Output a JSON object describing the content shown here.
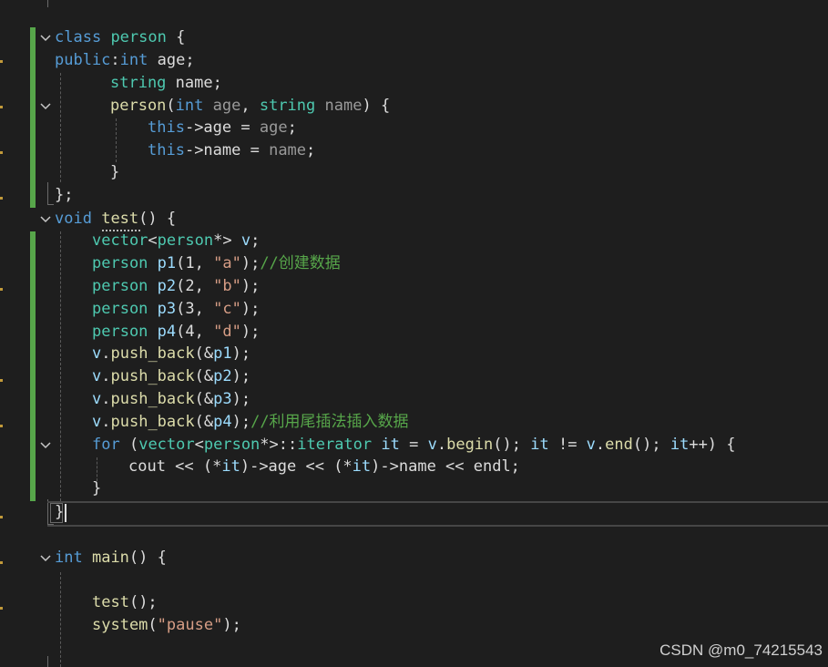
{
  "editor": {
    "lines": [
      [
        {
          "c": "kw",
          "t": "class"
        },
        {
          "c": "pl",
          "t": " "
        },
        {
          "c": "ty",
          "t": "person"
        },
        {
          "c": "pl",
          "t": " {"
        }
      ],
      [
        {
          "c": "kw",
          "t": "public"
        },
        {
          "c": "pl",
          "t": ":"
        },
        {
          "c": "kw",
          "t": "int"
        },
        {
          "c": "pl",
          "t": " "
        },
        {
          "c": "pl",
          "t": "age;"
        }
      ],
      [
        {
          "c": "ty",
          "t": "string"
        },
        {
          "c": "pl",
          "t": " name;"
        }
      ],
      [
        {
          "c": "fn",
          "t": "person"
        },
        {
          "c": "pl",
          "t": "("
        },
        {
          "c": "kw",
          "t": "int"
        },
        {
          "c": "pl",
          "t": " "
        },
        {
          "c": "pm",
          "t": "age"
        },
        {
          "c": "pl",
          "t": ", "
        },
        {
          "c": "ty",
          "t": "string"
        },
        {
          "c": "pl",
          "t": " "
        },
        {
          "c": "pm",
          "t": "name"
        },
        {
          "c": "pl",
          "t": ") {"
        }
      ],
      [
        {
          "c": "kw",
          "t": "this"
        },
        {
          "c": "pl",
          "t": "->age = "
        },
        {
          "c": "pm",
          "t": "age"
        },
        {
          "c": "pl",
          "t": ";"
        }
      ],
      [
        {
          "c": "kw",
          "t": "this"
        },
        {
          "c": "pl",
          "t": "->name = "
        },
        {
          "c": "pm",
          "t": "name"
        },
        {
          "c": "pl",
          "t": ";"
        }
      ],
      [
        {
          "c": "pl",
          "t": "}"
        }
      ],
      [
        {
          "c": "pl",
          "t": "};"
        }
      ],
      [
        {
          "c": "kw",
          "t": "void"
        },
        {
          "c": "pl",
          "t": " "
        },
        {
          "c": "fn",
          "t": "test"
        },
        {
          "c": "pl",
          "t": "() {"
        }
      ],
      [
        {
          "c": "ty",
          "t": "vector"
        },
        {
          "c": "pl",
          "t": "<"
        },
        {
          "c": "ty",
          "t": "person"
        },
        {
          "c": "pl",
          "t": "*> "
        },
        {
          "c": "lv",
          "t": "v"
        },
        {
          "c": "pl",
          "t": ";"
        }
      ],
      [
        {
          "c": "ty",
          "t": "person"
        },
        {
          "c": "pl",
          "t": " "
        },
        {
          "c": "lv",
          "t": "p1"
        },
        {
          "c": "pl",
          "t": "(1, "
        },
        {
          "c": "st",
          "t": "\"a\""
        },
        {
          "c": "pl",
          "t": ");"
        },
        {
          "c": "cm",
          "t": "//创建数据"
        }
      ],
      [
        {
          "c": "ty",
          "t": "person"
        },
        {
          "c": "pl",
          "t": " "
        },
        {
          "c": "lv",
          "t": "p2"
        },
        {
          "c": "pl",
          "t": "(2, "
        },
        {
          "c": "st",
          "t": "\"b\""
        },
        {
          "c": "pl",
          "t": ");"
        }
      ],
      [
        {
          "c": "ty",
          "t": "person"
        },
        {
          "c": "pl",
          "t": " "
        },
        {
          "c": "lv",
          "t": "p3"
        },
        {
          "c": "pl",
          "t": "(3, "
        },
        {
          "c": "st",
          "t": "\"c\""
        },
        {
          "c": "pl",
          "t": ");"
        }
      ],
      [
        {
          "c": "ty",
          "t": "person"
        },
        {
          "c": "pl",
          "t": " "
        },
        {
          "c": "lv",
          "t": "p4"
        },
        {
          "c": "pl",
          "t": "(4, "
        },
        {
          "c": "st",
          "t": "\"d\""
        },
        {
          "c": "pl",
          "t": ");"
        }
      ],
      [
        {
          "c": "lv",
          "t": "v"
        },
        {
          "c": "pl",
          "t": "."
        },
        {
          "c": "fn",
          "t": "push_back"
        },
        {
          "c": "pl",
          "t": "(&"
        },
        {
          "c": "lv",
          "t": "p1"
        },
        {
          "c": "pl",
          "t": ");"
        }
      ],
      [
        {
          "c": "lv",
          "t": "v"
        },
        {
          "c": "pl",
          "t": "."
        },
        {
          "c": "fn",
          "t": "push_back"
        },
        {
          "c": "pl",
          "t": "(&"
        },
        {
          "c": "lv",
          "t": "p2"
        },
        {
          "c": "pl",
          "t": ");"
        }
      ],
      [
        {
          "c": "lv",
          "t": "v"
        },
        {
          "c": "pl",
          "t": "."
        },
        {
          "c": "fn",
          "t": "push_back"
        },
        {
          "c": "pl",
          "t": "(&"
        },
        {
          "c": "lv",
          "t": "p3"
        },
        {
          "c": "pl",
          "t": ");"
        }
      ],
      [
        {
          "c": "lv",
          "t": "v"
        },
        {
          "c": "pl",
          "t": "."
        },
        {
          "c": "fn",
          "t": "push_back"
        },
        {
          "c": "pl",
          "t": "(&"
        },
        {
          "c": "lv",
          "t": "p4"
        },
        {
          "c": "pl",
          "t": ");"
        },
        {
          "c": "cm",
          "t": "//利用尾插法插入数据"
        }
      ],
      [
        {
          "c": "kw",
          "t": "for"
        },
        {
          "c": "pl",
          "t": " ("
        },
        {
          "c": "ty",
          "t": "vector"
        },
        {
          "c": "pl",
          "t": "<"
        },
        {
          "c": "ty",
          "t": "person"
        },
        {
          "c": "pl",
          "t": "*>::"
        },
        {
          "c": "ty",
          "t": "iterator"
        },
        {
          "c": "pl",
          "t": " "
        },
        {
          "c": "lv",
          "t": "it"
        },
        {
          "c": "pl",
          "t": " = "
        },
        {
          "c": "lv",
          "t": "v"
        },
        {
          "c": "pl",
          "t": "."
        },
        {
          "c": "fn",
          "t": "begin"
        },
        {
          "c": "pl",
          "t": "(); "
        },
        {
          "c": "lv",
          "t": "it"
        },
        {
          "c": "pl",
          "t": " != "
        },
        {
          "c": "lv",
          "t": "v"
        },
        {
          "c": "pl",
          "t": "."
        },
        {
          "c": "fn",
          "t": "end"
        },
        {
          "c": "pl",
          "t": "(); "
        },
        {
          "c": "lv",
          "t": "it"
        },
        {
          "c": "pl",
          "t": "++) {"
        }
      ],
      [
        {
          "c": "pl",
          "t": "cout << (*"
        },
        {
          "c": "lv",
          "t": "it"
        },
        {
          "c": "pl",
          "t": ")->age << (*"
        },
        {
          "c": "lv",
          "t": "it"
        },
        {
          "c": "pl",
          "t": ")->name << endl;"
        }
      ],
      [
        {
          "c": "pl",
          "t": "}"
        }
      ],
      [
        {
          "c": "pl",
          "t": "}"
        }
      ],
      [],
      [
        {
          "c": "kw",
          "t": "int"
        },
        {
          "c": "pl",
          "t": " "
        },
        {
          "c": "fn",
          "t": "main"
        },
        {
          "c": "pl",
          "t": "() {"
        }
      ],
      [],
      [
        {
          "c": "fn",
          "t": "test"
        },
        {
          "c": "pl",
          "t": "();"
        }
      ],
      [
        {
          "c": "fn",
          "t": "system"
        },
        {
          "c": "pl",
          "t": "("
        },
        {
          "c": "st",
          "t": "\"pause\""
        },
        {
          "c": "pl",
          "t": ");"
        }
      ]
    ]
  },
  "watermark": "CSDN @m0_74215543"
}
